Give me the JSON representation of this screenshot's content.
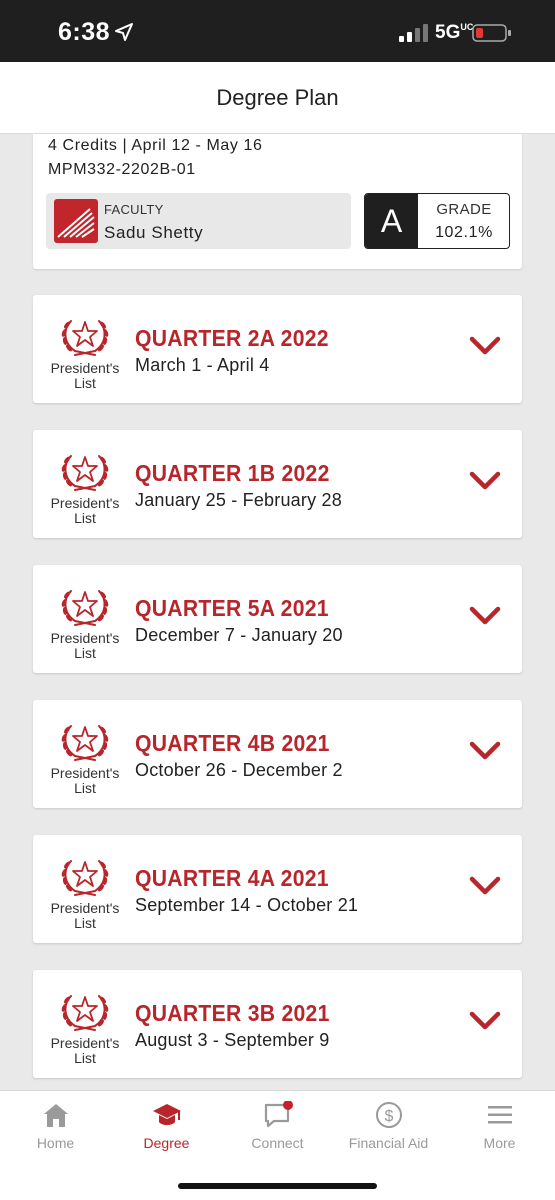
{
  "status_bar": {
    "time": "6:38",
    "network": "5G",
    "network_sub": "UC",
    "battery_color": "#e03a32",
    "icons": [
      "location-arrow-icon",
      "signal-icon",
      "battery-icon"
    ]
  },
  "header": {
    "title": "Degree Plan"
  },
  "course": {
    "meta_line1": "4 Credits | April 12 - May 16",
    "meta_line2": "MPM332-2202B-01",
    "faculty_label": "FACULTY",
    "faculty_name": "Sadu Shetty",
    "grade_letter": "A",
    "grade_label": "GRADE",
    "grade_value": "102.1%"
  },
  "badge_text_line1": "President's",
  "badge_text_line2": "List",
  "quarters": [
    {
      "title": "QUARTER 2A 2022",
      "dates": "March 1 - April 4"
    },
    {
      "title": "QUARTER 1B 2022",
      "dates": "January 25 - February 28"
    },
    {
      "title": "QUARTER 5A 2021",
      "dates": "December 7 - January 20"
    },
    {
      "title": "QUARTER 4B 2021",
      "dates": "October 26 - December 2"
    },
    {
      "title": "QUARTER 4A 2021",
      "dates": "September 14 - October 21"
    },
    {
      "title": "QUARTER 3B 2021",
      "dates": "August 3 - September 9"
    }
  ],
  "tabs": [
    {
      "label": "Home",
      "icon": "home-icon",
      "active": false
    },
    {
      "label": "Degree",
      "icon": "graduation-cap-icon",
      "active": true
    },
    {
      "label": "Connect",
      "icon": "chat-icon",
      "active": false,
      "has_notification": true
    },
    {
      "label": "Financial Aid",
      "icon": "dollar-icon",
      "active": false
    },
    {
      "label": "More",
      "icon": "menu-icon",
      "active": false
    }
  ],
  "colors": {
    "accent": "#b8262b",
    "status_bar_bg": "#1f1f1f",
    "page_bg": "#e9e9e9",
    "inactive_tab": "#9a9a9a"
  }
}
